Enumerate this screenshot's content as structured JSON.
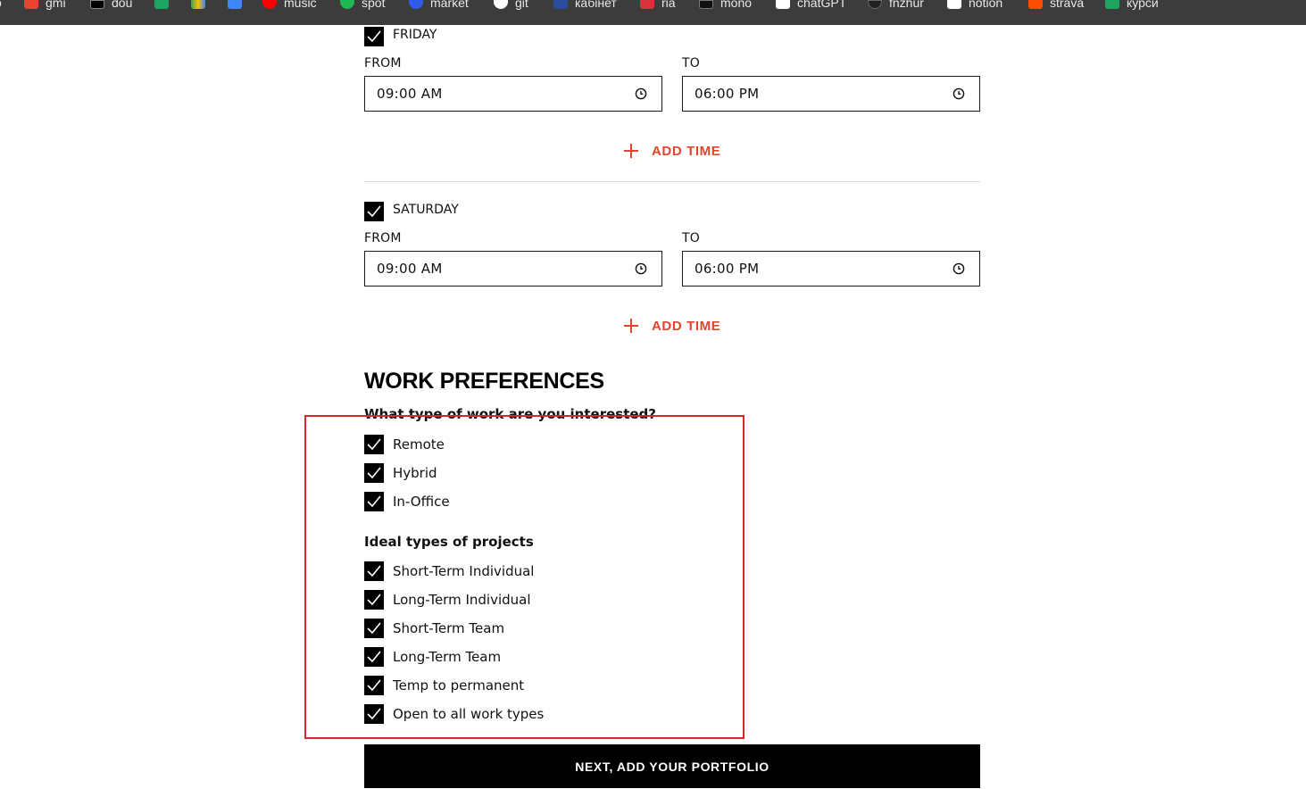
{
  "bookmarks": [
    {
      "label": "gmi",
      "icon": "gmail-icon",
      "color": "#ea4335"
    },
    {
      "label": "dou",
      "icon": "dou-icon",
      "color": "#000000"
    },
    {
      "label": "",
      "icon": "sheets-icon",
      "color": "#1fa463"
    },
    {
      "label": "",
      "icon": "drive-icon",
      "color": "#4285f4"
    },
    {
      "label": "",
      "icon": "calendar-icon",
      "color": "#4285f4"
    },
    {
      "label": "music",
      "icon": "youtube-music-icon",
      "color": "#ff0000"
    },
    {
      "label": "spot",
      "icon": "spotify-icon",
      "color": "#1db954"
    },
    {
      "label": "market",
      "icon": "market-icon",
      "color": "#2f5bea"
    },
    {
      "label": "git",
      "icon": "github-icon",
      "color": "#ffffff"
    },
    {
      "label": "кабінет",
      "icon": "cabinet-icon",
      "color": "#2a4c9a"
    },
    {
      "label": "ria",
      "icon": "ria-icon",
      "color": "#d6333a"
    },
    {
      "label": "mono",
      "icon": "mono-icon",
      "color": "#111111"
    },
    {
      "label": "chatGPT",
      "icon": "chatgpt-icon",
      "color": "#ffffff"
    },
    {
      "label": "fnzhur",
      "icon": "fnzhur-icon",
      "color": "#222222"
    },
    {
      "label": "notion",
      "icon": "notion-icon",
      "color": "#ffffff"
    },
    {
      "label": "strava",
      "icon": "strava-icon",
      "color": "#fc4c02"
    },
    {
      "label": "курси",
      "icon": "courses-icon",
      "color": "#1fa463"
    }
  ],
  "schedule": [
    {
      "day": "FRIDAY",
      "from_label": "FROM",
      "to_label": "TO",
      "from": "09:00 AM",
      "to": "06:00 PM",
      "add_time": "ADD TIME"
    },
    {
      "day": "SATURDAY",
      "from_label": "FROM",
      "to_label": "TO",
      "from": "09:00 AM",
      "to": "06:00 PM",
      "add_time": "ADD TIME"
    }
  ],
  "work_preferences": {
    "title": "WORK PREFERENCES",
    "question": "What type of work are you interested?",
    "work_types": [
      "Remote",
      "Hybrid",
      "In-Office"
    ],
    "projects_title": "Ideal types of projects",
    "project_types": [
      "Short-Term Individual",
      "Long-Term Individual",
      "Short-Term Team",
      "Long-Term Team",
      "Temp to permanent",
      "Open to all work types"
    ]
  },
  "next_button": "NEXT, ADD YOUR PORTFOLIO",
  "colors": {
    "accent": "#e2452f",
    "annotation": "#d7262b",
    "bookmark_bar": "#3c3c3c"
  }
}
